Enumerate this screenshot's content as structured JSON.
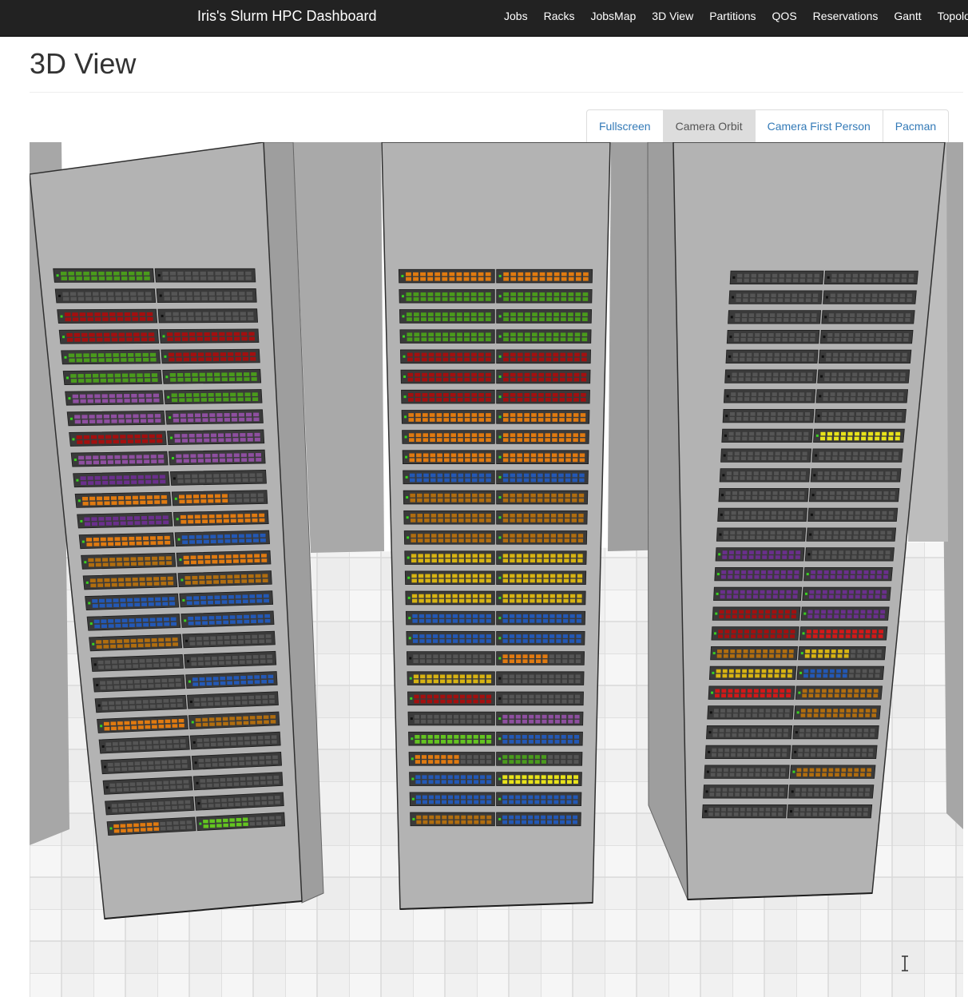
{
  "app": {
    "title": "Iris's Slurm HPC Dashboard"
  },
  "nav": {
    "items": [
      {
        "label": "Jobs"
      },
      {
        "label": "Racks"
      },
      {
        "label": "JobsMap"
      },
      {
        "label": "3D View"
      },
      {
        "label": "Partitions"
      },
      {
        "label": "QOS"
      },
      {
        "label": "Reservations"
      },
      {
        "label": "Gantt"
      },
      {
        "label": "Topology"
      }
    ]
  },
  "page": {
    "title": "3D View"
  },
  "controls": {
    "fullscreen": "Fullscreen",
    "camera_orbit": "Camera Orbit",
    "camera_first_person": "Camera First Person",
    "pacman": "Pacman",
    "active": "Camera Orbit"
  },
  "colors": {
    "navbar": "#222222",
    "link": "#337ab7",
    "rack": "#b3b3b3",
    "chassis": "#3a3a3a",
    "idle": "#555555",
    "job_colors": [
      "#4a9b1c",
      "#a30f0f",
      "#8e4fa0",
      "#e07a10",
      "#2358b5",
      "#b06d0f",
      "#d7b312",
      "#6a2f8c",
      "#d31818",
      "#63c420",
      "#e8e31a"
    ]
  },
  "scene": {
    "racks": [
      {
        "chassis": [
          [
            "0",
            "-"
          ],
          [
            "-",
            "-"
          ],
          [
            "1",
            "-"
          ],
          [
            "1",
            "1"
          ],
          [
            "0",
            "1"
          ],
          [
            "0",
            "0"
          ],
          [
            "2",
            "0"
          ],
          [
            "2",
            "2"
          ],
          [
            "1",
            "2"
          ],
          [
            "2",
            "2"
          ],
          [
            "7",
            "-"
          ],
          [
            "3",
            "3m"
          ],
          [
            "7",
            "3"
          ],
          [
            "3",
            "4"
          ],
          [
            "5",
            "3"
          ],
          [
            "5",
            "5"
          ],
          [
            "4",
            "4"
          ],
          [
            "4",
            "4"
          ],
          [
            "5",
            "-"
          ],
          [
            "-",
            "-"
          ],
          [
            "-",
            "4"
          ],
          [
            "-",
            "-"
          ],
          [
            "3",
            "5"
          ],
          [
            "-",
            "-"
          ],
          [
            "-",
            "-"
          ],
          [
            "-",
            "-"
          ],
          [
            "-",
            "-"
          ],
          [
            "3m",
            "9m"
          ]
        ]
      },
      {
        "chassis": [
          [
            "3",
            "3"
          ],
          [
            "0",
            "0"
          ],
          [
            "0",
            "0"
          ],
          [
            "0",
            "0"
          ],
          [
            "1",
            "1"
          ],
          [
            "1",
            "1"
          ],
          [
            "1",
            "1"
          ],
          [
            "3",
            "3"
          ],
          [
            "3",
            "3"
          ],
          [
            "3",
            "3"
          ],
          [
            "4",
            "4"
          ],
          [
            "5",
            "5"
          ],
          [
            "5",
            "5"
          ],
          [
            "5",
            "5"
          ],
          [
            "6",
            "6"
          ],
          [
            "6",
            "6"
          ],
          [
            "6",
            "6"
          ],
          [
            "4",
            "4"
          ],
          [
            "4",
            "4"
          ],
          [
            "-",
            "3m"
          ],
          [
            "6",
            "-"
          ],
          [
            "1",
            "-"
          ],
          [
            "-",
            "2"
          ],
          [
            "9",
            "4"
          ],
          [
            "3m",
            "0m"
          ],
          [
            "4",
            "10"
          ],
          [
            "4",
            "4"
          ],
          [
            "5",
            "4"
          ]
        ]
      },
      {
        "chassis": [
          [
            "-",
            "-"
          ],
          [
            "-",
            "-"
          ],
          [
            "-",
            "-"
          ],
          [
            "-",
            "-"
          ],
          [
            "-",
            "-"
          ],
          [
            "-",
            "-"
          ],
          [
            "-",
            "-"
          ],
          [
            "-",
            "-"
          ],
          [
            "-",
            "10"
          ],
          [
            "-",
            "-"
          ],
          [
            "-",
            "-"
          ],
          [
            "-",
            "-"
          ],
          [
            "-",
            "-"
          ],
          [
            "-",
            "-"
          ],
          [
            "7",
            "-"
          ],
          [
            "7",
            "7"
          ],
          [
            "7",
            "7"
          ],
          [
            "1",
            "7"
          ],
          [
            "1",
            "8"
          ],
          [
            "5",
            "6m"
          ],
          [
            "6",
            "4m"
          ],
          [
            "8",
            "5"
          ],
          [
            "-",
            "5"
          ],
          [
            "-",
            "-"
          ],
          [
            "-",
            "-"
          ],
          [
            "-",
            "5"
          ],
          [
            "-",
            "-"
          ],
          [
            "-",
            "-"
          ]
        ]
      }
    ]
  }
}
